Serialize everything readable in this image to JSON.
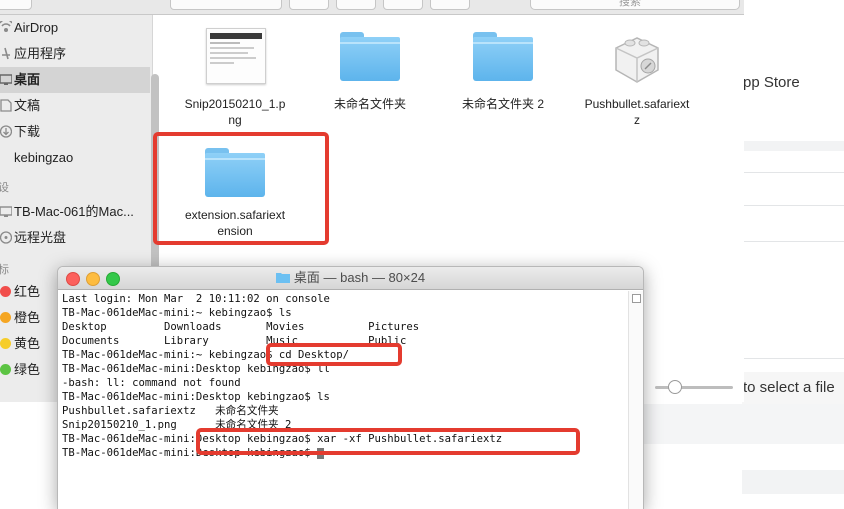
{
  "background_page": {
    "app_store_text": "pp Store",
    "select_file_text": "to select a file"
  },
  "finder": {
    "search_placeholder": "搜索",
    "sidebar_items": [
      {
        "label": "AirDrop",
        "icon": "airdrop-icon"
      },
      {
        "label": "应用程序",
        "icon": "applications-icon"
      },
      {
        "label": "桌面",
        "icon": "desktop-icon",
        "selected": true
      },
      {
        "label": "文稿",
        "icon": "documents-icon"
      },
      {
        "label": "下载",
        "icon": "downloads-icon"
      },
      {
        "label": "kebingzao",
        "icon": "home-icon"
      }
    ],
    "devices_header": "设",
    "device_items": [
      {
        "label": "TB-Mac-061的Mac...",
        "icon": "computer-icon"
      },
      {
        "label": "远程光盘",
        "icon": "remote-disc-icon"
      }
    ],
    "tags_header": "标",
    "tags": [
      {
        "label": "红色",
        "color": "#f14e4b"
      },
      {
        "label": "橙色",
        "color": "#f5a623"
      },
      {
        "label": "黄色",
        "color": "#f6cd2a"
      },
      {
        "label": "绿色",
        "color": "#5cc443"
      }
    ],
    "files": [
      {
        "name_line1": "Snip20150210_1.p",
        "name_line2": "ng",
        "icon": "image-thumbnail-icon"
      },
      {
        "name_line1": "未命名文件夹",
        "name_line2": "",
        "icon": "folder-icon"
      },
      {
        "name_line1": "未命名文件夹 2",
        "name_line2": "",
        "icon": "folder-icon"
      },
      {
        "name_line1": "Pushbullet.safariext",
        "name_line2": "z",
        "icon": "safari-extension-icon"
      },
      {
        "name_line1": "extension.safariext",
        "name_line2": "ension",
        "icon": "folder-icon"
      }
    ]
  },
  "terminal": {
    "title": "桌面 — bash — 80×24",
    "lines": [
      "Last login: Mon Mar  2 10:11:02 on console",
      "TB-Mac-061deMac-mini:~ kebingzao$ ls",
      "Desktop         Downloads       Movies          Pictures",
      "Documents       Library         Music           Public",
      "TB-Mac-061deMac-mini:~ kebingzao$ cd Desktop/",
      "TB-Mac-061deMac-mini:Desktop kebingzao$ ll",
      "-bash: ll: command not found",
      "TB-Mac-061deMac-mini:Desktop kebingzao$ ls",
      "Pushbullet.safariextz   未命名文件夹",
      "Snip20150210_1.png      未命名文件夹 2",
      "TB-Mac-061deMac-mini:Desktop kebingzao$ xar -xf Pushbullet.safariextz",
      "TB-Mac-061deMac-mini:Desktop kebingzao$ "
    ]
  },
  "colors": {
    "highlight_red": "#e43b2f",
    "folder_blue": "#6cc0f2",
    "close_red": "#fc605c",
    "minimize_yellow": "#fdbc40",
    "zoom_green": "#34c84a"
  }
}
